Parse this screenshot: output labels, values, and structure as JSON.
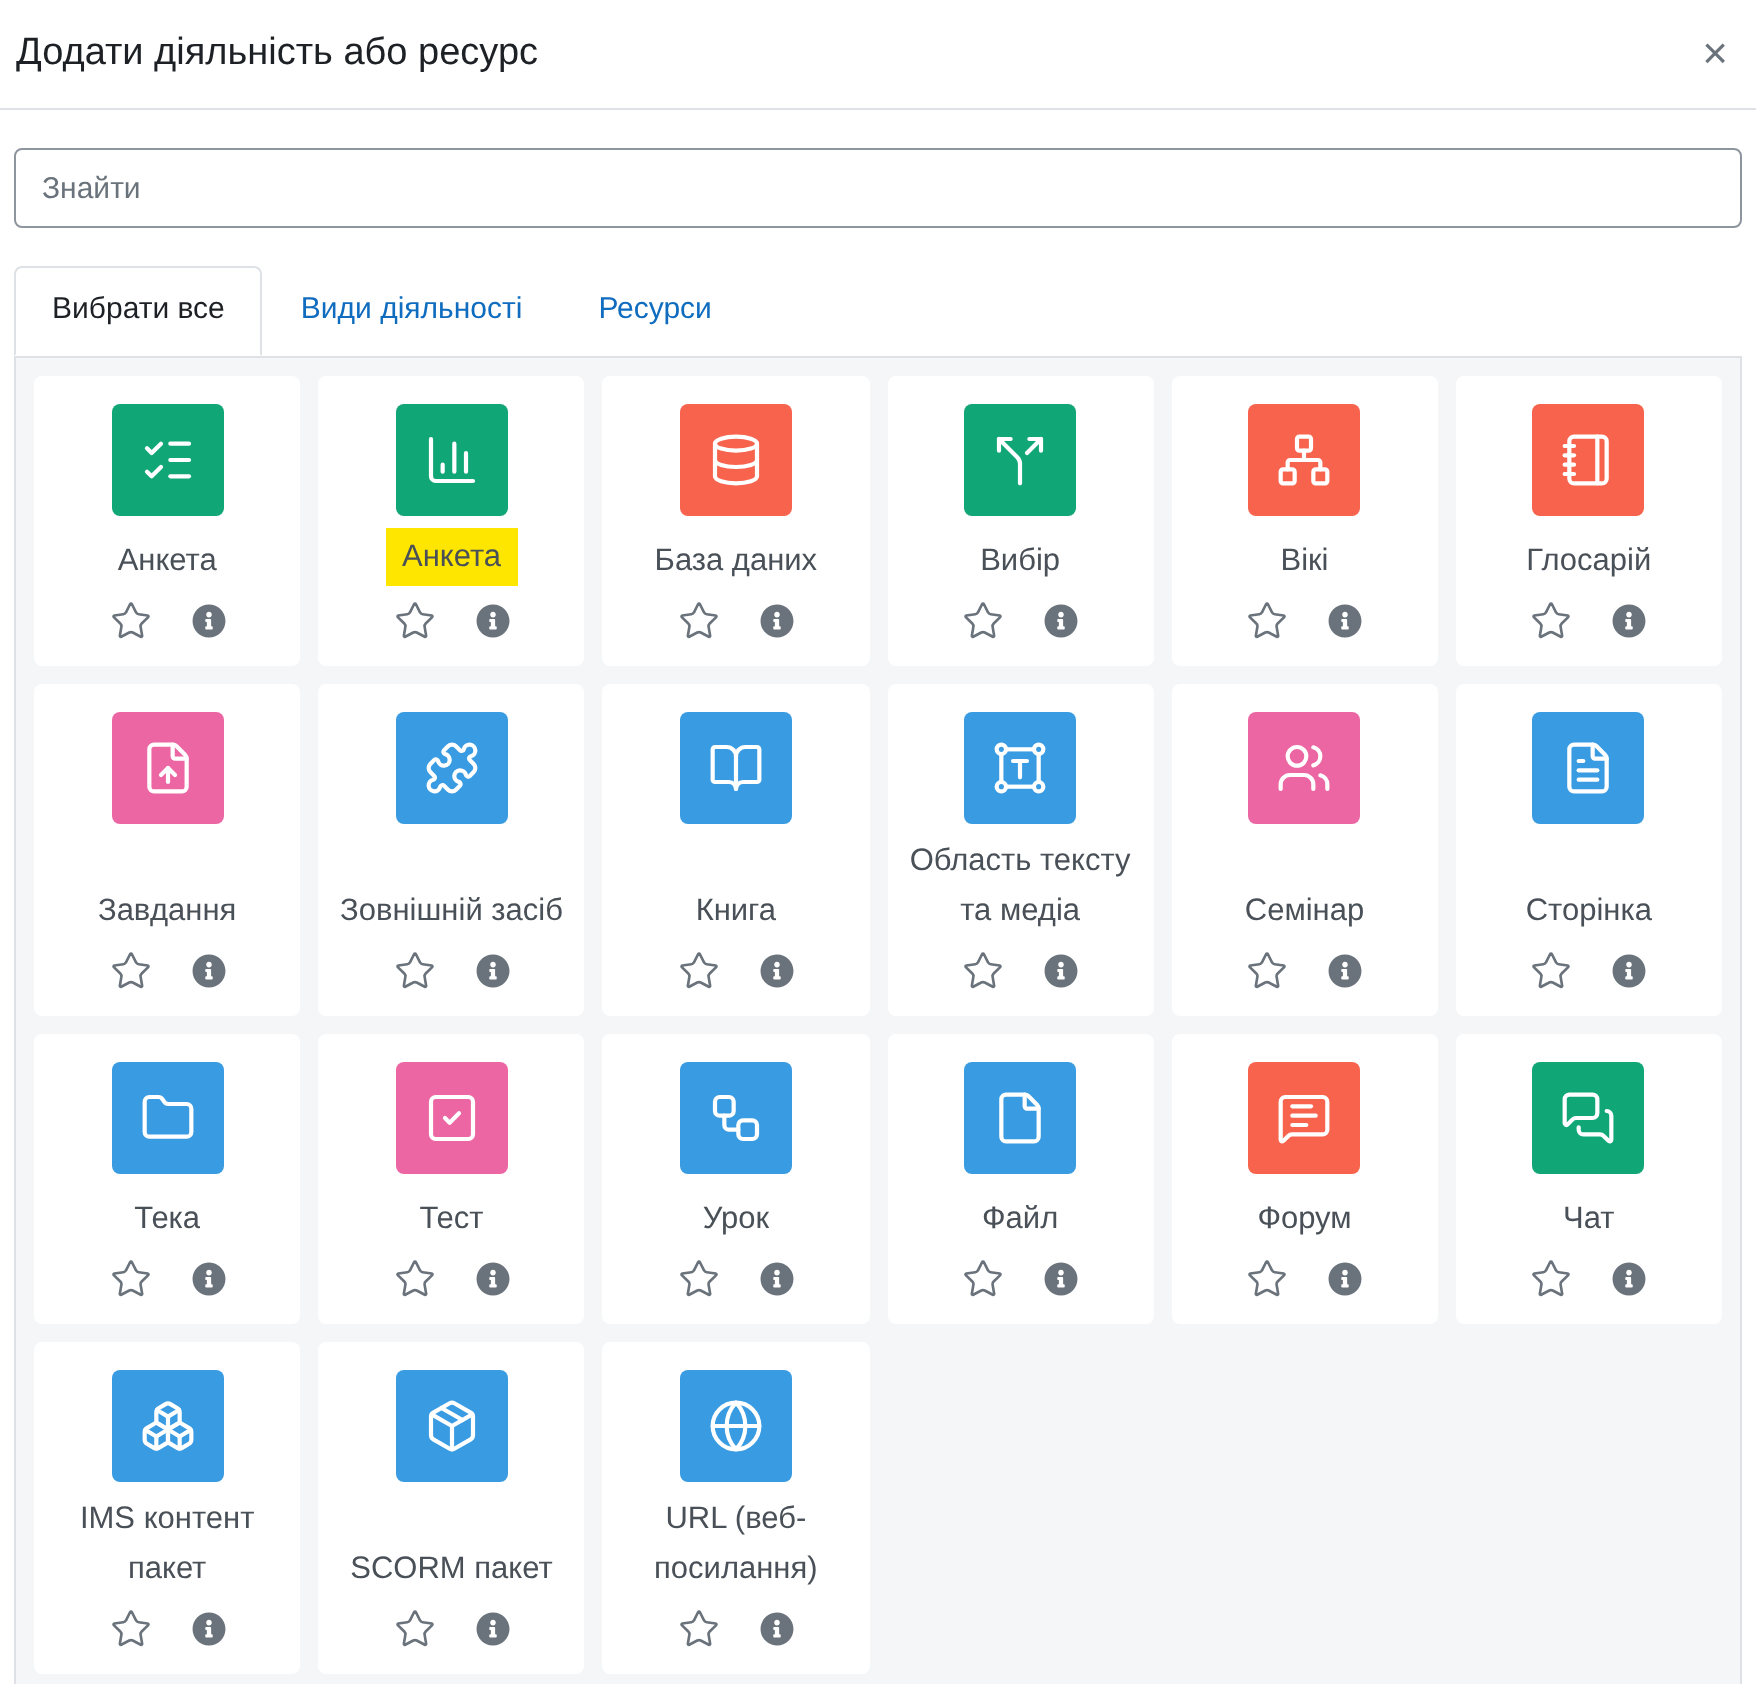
{
  "dialog": {
    "title": "Додати діяльність або ресурс",
    "close": "×"
  },
  "search": {
    "placeholder": "Знайти"
  },
  "tabs": [
    {
      "label": "Вибрати все",
      "selected": true
    },
    {
      "label": "Види діяльності",
      "selected": false
    },
    {
      "label": "Ресурси",
      "selected": false
    }
  ],
  "items": [
    {
      "label": "Анкета",
      "kind": "survey",
      "color": "#11a676",
      "highlighted": false,
      "starred": false
    },
    {
      "label": "Анкета",
      "kind": "chart",
      "color": "#11a676",
      "highlighted": true,
      "starred": false
    },
    {
      "label": "База даних",
      "kind": "database",
      "color": "#f7634d",
      "highlighted": false,
      "starred": false
    },
    {
      "label": "Вибір",
      "kind": "split",
      "color": "#11a676",
      "highlighted": false,
      "starred": false
    },
    {
      "label": "Вікі",
      "kind": "network",
      "color": "#f7634d",
      "highlighted": false,
      "starred": false
    },
    {
      "label": "Глосарій",
      "kind": "notebook",
      "color": "#f7634d",
      "highlighted": false,
      "starred": false
    },
    {
      "label": "Завдання",
      "kind": "upload",
      "color": "#eb66a2",
      "highlighted": false,
      "starred": false
    },
    {
      "label": "Зовнішній засіб",
      "kind": "puzzle",
      "color": "#399be2",
      "highlighted": false,
      "starred": false
    },
    {
      "label": "Книга",
      "kind": "book",
      "color": "#399be2",
      "highlighted": false,
      "starred": false
    },
    {
      "label": "Область тексту та медіа",
      "kind": "textframe",
      "color": "#399be2",
      "highlighted": false,
      "starred": false
    },
    {
      "label": "Семінар",
      "kind": "people",
      "color": "#eb66a2",
      "highlighted": false,
      "starred": false
    },
    {
      "label": "Сторінка",
      "kind": "page",
      "color": "#399be2",
      "highlighted": false,
      "starred": false
    },
    {
      "label": "Тека",
      "kind": "folder",
      "color": "#399be2",
      "highlighted": false,
      "starred": false
    },
    {
      "label": "Тест",
      "kind": "check",
      "color": "#eb66a2",
      "highlighted": false,
      "starred": false
    },
    {
      "label": "Урок",
      "kind": "route",
      "color": "#399be2",
      "highlighted": false,
      "starred": false
    },
    {
      "label": "Файл",
      "kind": "file",
      "color": "#399be2",
      "highlighted": false,
      "starred": false
    },
    {
      "label": "Форум",
      "kind": "forum",
      "color": "#f7634d",
      "highlighted": false,
      "starred": false
    },
    {
      "label": "Чат",
      "kind": "chat",
      "color": "#11a676",
      "highlighted": false,
      "starred": false
    },
    {
      "label": "IMS контент пакет",
      "kind": "boxes",
      "color": "#399be2",
      "highlighted": false,
      "starred": false
    },
    {
      "label": "SCORM пакет",
      "kind": "package",
      "color": "#399be2",
      "highlighted": false,
      "starred": false
    },
    {
      "label": "URL (веб-посилання)",
      "kind": "globe",
      "color": "#399be2",
      "highlighted": false,
      "starred": false
    }
  ]
}
